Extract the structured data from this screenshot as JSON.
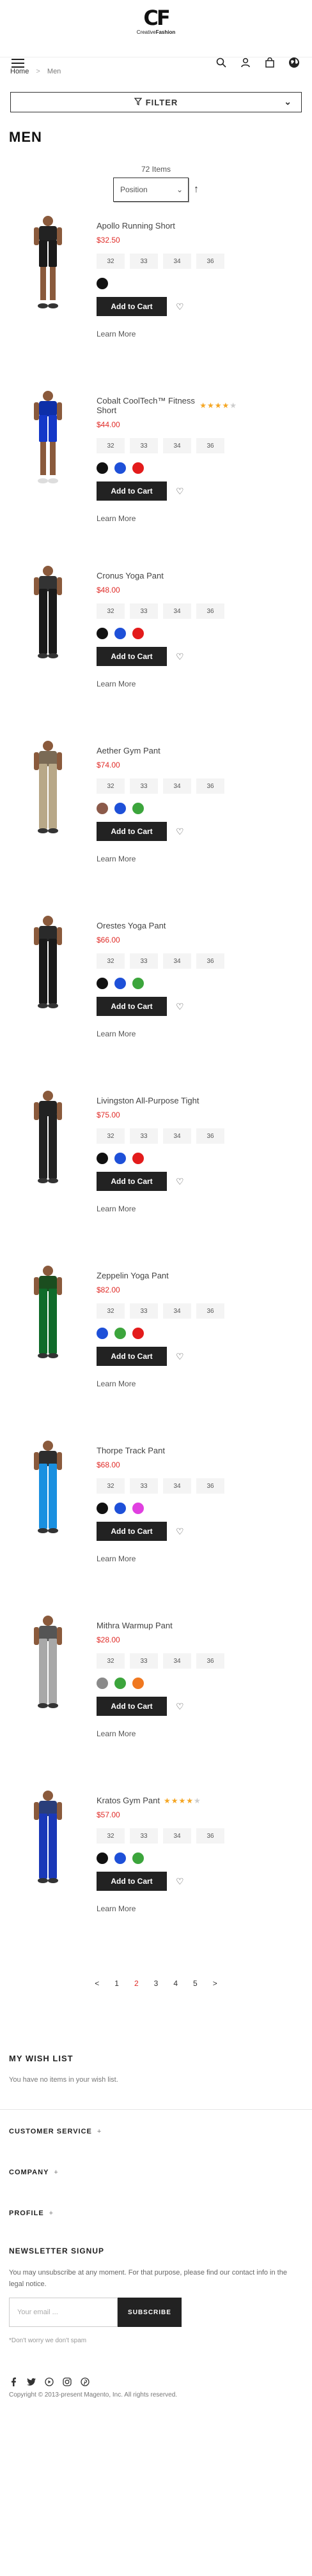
{
  "header": {
    "logo_mark": "CF",
    "logo_text_light": "Creative",
    "logo_text_bold": "Fashion",
    "icons": [
      "menu-icon",
      "search-icon",
      "account-icon",
      "cart-icon",
      "globe-icon"
    ]
  },
  "breadcrumb": {
    "home": "Home",
    "separator": ">",
    "current": "Men"
  },
  "filter": {
    "label": "FILTER"
  },
  "page_title": "MEN",
  "toolbar": {
    "item_count": "72 Items",
    "sort_value": "Position"
  },
  "product_common": {
    "sizes": [
      "32",
      "33",
      "34",
      "36"
    ],
    "add_to_cart": "Add to Cart",
    "learn_more": "Learn More"
  },
  "products": [
    {
      "name": "Apollo Running Short",
      "price": "$32.50",
      "rating": 0,
      "swatches": [
        "#111111"
      ],
      "image": "shorts-black",
      "pants_color": "#1a1a1a",
      "shirt": "#222222"
    },
    {
      "name": "Cobalt CoolTech™ Fitness Short",
      "price": "$44.00",
      "rating": 4,
      "swatches": [
        "#111111",
        "#1e50d8",
        "#e31b1b"
      ],
      "image": "shorts-blue",
      "pants_color": "#1438c8",
      "shirt": "#0d2fa8"
    },
    {
      "name": "Cronus Yoga Pant",
      "price": "$48.00",
      "rating": 0,
      "swatches": [
        "#111111",
        "#1e50d8",
        "#e31b1b"
      ],
      "image": "pant-black",
      "pants_color": "#1a1a1a",
      "shirt": "#333333"
    },
    {
      "name": "Aether Gym Pant",
      "price": "$74.00",
      "rating": 0,
      "swatches": [
        "#8b5a4a",
        "#1e50d8",
        "#3ca53c"
      ],
      "image": "pant-khaki",
      "pants_color": "#b8a888",
      "shirt": "#7a6a55"
    },
    {
      "name": "Orestes Yoga Pant",
      "price": "$66.00",
      "rating": 0,
      "swatches": [
        "#111111",
        "#1e50d8",
        "#3ca53c"
      ],
      "image": "pant-black-2",
      "pants_color": "#1a1a1a",
      "shirt": "#2a2a2a"
    },
    {
      "name": "Livingston All-Purpose Tight",
      "price": "$75.00",
      "rating": 0,
      "swatches": [
        "#111111",
        "#1e50d8",
        "#e31b1b"
      ],
      "image": "tight-black",
      "pants_color": "#222222",
      "shirt": "#222222"
    },
    {
      "name": "Zeppelin Yoga Pant",
      "price": "$82.00",
      "rating": 0,
      "swatches": [
        "#1e50d8",
        "#3ca53c",
        "#e31b1b"
      ],
      "image": "pant-green",
      "pants_color": "#0f6b2a",
      "shirt": "#1b4d1f"
    },
    {
      "name": "Thorpe Track Pant",
      "price": "$68.00",
      "rating": 0,
      "swatches": [
        "#111111",
        "#1e50d8",
        "#e040e0"
      ],
      "image": "pant-blue",
      "pants_color": "#1a90e0",
      "shirt": "#2d2d2d"
    },
    {
      "name": "Mithra Warmup Pant",
      "price": "$28.00",
      "rating": 0,
      "swatches": [
        "#8a8a8a",
        "#3ca53c",
        "#f07820"
      ],
      "image": "pant-grey",
      "pants_color": "#a8a8a8",
      "shirt": "#555555"
    },
    {
      "name": "Kratos Gym Pant",
      "price": "$57.00",
      "rating": 4,
      "swatches": [
        "#111111",
        "#1e50d8",
        "#3ca53c"
      ],
      "image": "pant-royal",
      "pants_color": "#1a38b8",
      "shirt": "#2a3e7a"
    }
  ],
  "pagination": {
    "prev": "<",
    "pages": [
      "1",
      "2",
      "3",
      "4",
      "5"
    ],
    "current": "2",
    "next": ">"
  },
  "wishlist": {
    "title": "MY WISH LIST",
    "empty": "You have no items in your wish list."
  },
  "footer": {
    "sections": [
      "CUSTOMER SERVICE",
      "COMPANY",
      "PROFILE"
    ],
    "plus": "+",
    "newsletter_title": "NEWSLETTER SIGNUP",
    "newsletter_text": "You may unsubscribe at any moment. For that purpose, please find our contact info in the legal notice.",
    "email_placeholder": "Your email ...",
    "subscribe": "SUBSCRIBE",
    "note": "*Don't worry we don't spam",
    "socials": [
      "facebook-icon",
      "twitter-icon",
      "youtube-icon",
      "instagram-icon",
      "pinterest-icon"
    ],
    "copyright": "Copyright © 2013-present Magento, Inc. All rights reserved."
  }
}
